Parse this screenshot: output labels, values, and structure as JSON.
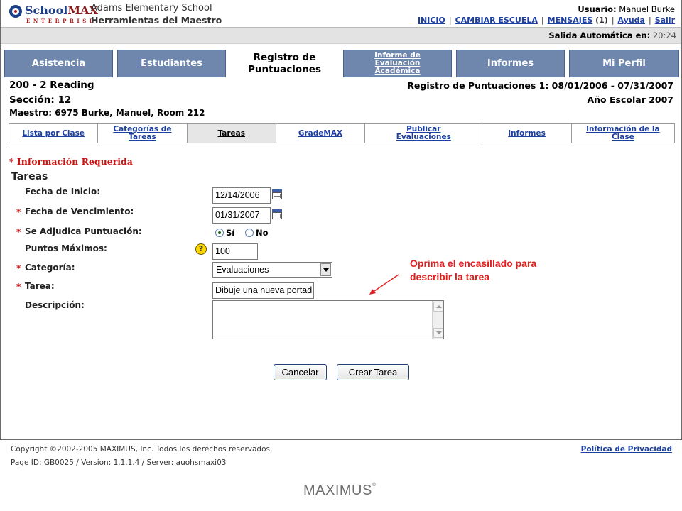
{
  "header": {
    "logo_text_school": "School",
    "logo_text_max": "MAX",
    "logo_sub": "ENTERPRISE",
    "school_name": "Adams Elementary School",
    "app_name": "Herramientas del Maestro",
    "user_label": "Usuario:",
    "user_name": "Manuel Burke",
    "nav": {
      "inicio": "INICIO",
      "cambiar": "CAMBIAR ESCUELA",
      "mensajes": "MENSAJES",
      "mensajes_count": "(1)",
      "ayuda": "Ayuda",
      "salir": "Salir",
      "separator": "|"
    },
    "timeout_label": "Salida Automática en:",
    "timeout_value": "20:24"
  },
  "tabs": [
    {
      "label": "Asistencia"
    },
    {
      "label": "Estudiantes"
    },
    {
      "label": "Registro de Puntuaciones"
    },
    {
      "label": "Informe de Evaluación Académica"
    },
    {
      "label": "Informes"
    },
    {
      "label": "Mi Perfil"
    }
  ],
  "class_info": {
    "course": "200 - 2 Reading",
    "section": "Sección: 12",
    "teacher": "Maestro: 6975 Burke, Manuel, Room 212",
    "register": "Registro de Puntuaciones 1: 08/01/2006 - 07/31/2007",
    "school_year": "Año Escolar 2007"
  },
  "subtabs": [
    {
      "label": "Lista por Clase"
    },
    {
      "label": "Categorías de Tareas"
    },
    {
      "label": "Tareas"
    },
    {
      "label": "GradeMAX"
    },
    {
      "label": "Publicar Evaluaciones"
    },
    {
      "label": "Informes"
    },
    {
      "label": "Información de la Clase"
    }
  ],
  "form": {
    "required_note": "* Información Requerida",
    "section_title": "Tareas",
    "star": "*",
    "labels": {
      "start_date": "Fecha de Inicio:",
      "due_date": "Fecha de Vencimiento:",
      "graded": "Se Adjudica Puntuación:",
      "max_points": "Puntos Máximos:",
      "category": "Categoría:",
      "task": "Tarea:",
      "description": "Descripción:"
    },
    "values": {
      "start_date": "12/14/2006",
      "due_date": "01/31/2007",
      "graded_yes": "Sí",
      "graded_no": "No",
      "max_points": "100",
      "category": "Evaluaciones",
      "task": "Dibuje una nueva portad",
      "description": ""
    },
    "help_icon_text": "?",
    "buttons": {
      "cancel": "Cancelar",
      "create": "Crear Tarea"
    }
  },
  "callout": {
    "line1": "Oprima el encasillado para",
    "line2": "describir la tarea",
    "color": "#e02020"
  },
  "footer": {
    "copyright": "Copyright ©2002-2005 MAXIMUS, Inc. Todos los derechos reservados.",
    "privacy": "Política de Privacidad",
    "page_id": "Page ID: GB0025 / Version: 1.1.1.4 / Server: auohsmaxi03",
    "brand": "MAXIMUS"
  },
  "colors": {
    "tab_blue": "#6f86ad",
    "link_blue": "#1c3fa0",
    "required_red": "#cc1111"
  }
}
